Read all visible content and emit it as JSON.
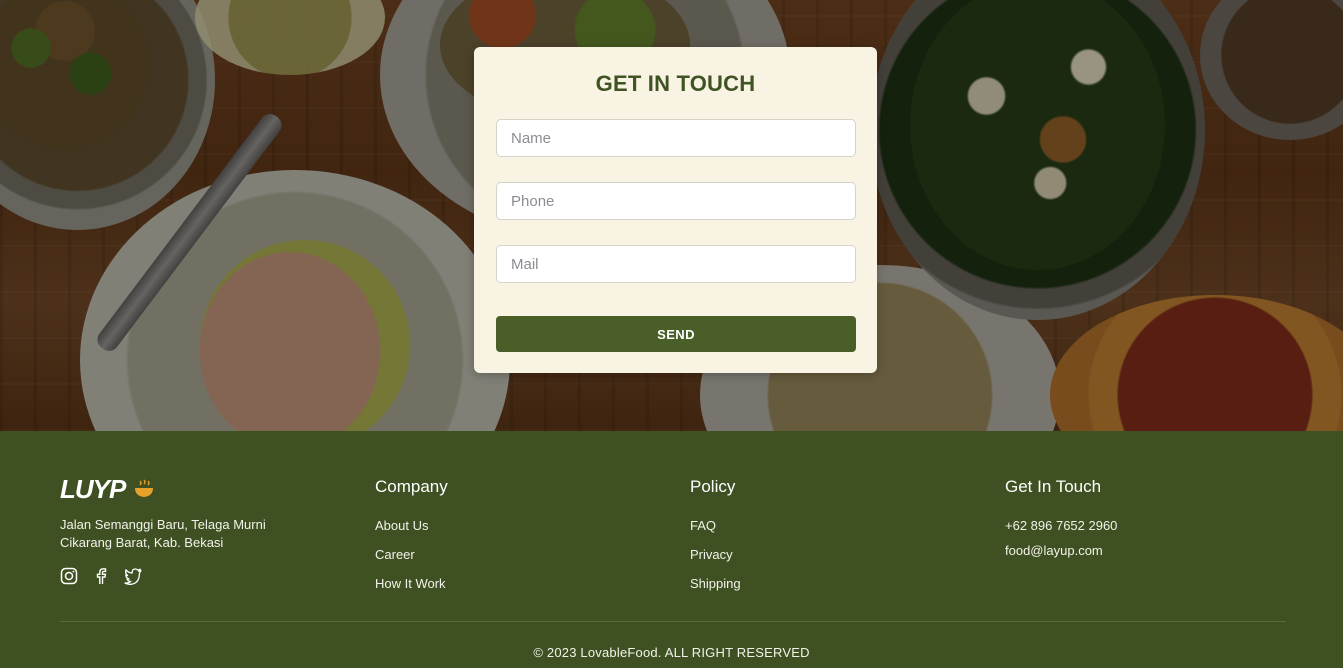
{
  "form": {
    "title": "GET IN TOUCH",
    "name_placeholder": "Name",
    "phone_placeholder": "Phone",
    "mail_placeholder": "Mail",
    "send_label": "SEND"
  },
  "footer": {
    "logo_text": "LUYP",
    "address": "Jalan Semanggi Baru, Telaga Murni Cikarang Barat, Kab. Bekasi",
    "social_icons": [
      "instagram-icon",
      "facebook-icon",
      "twitter-icon"
    ],
    "company": {
      "heading": "Company",
      "links": [
        "About Us",
        "Career",
        "How It Work"
      ]
    },
    "policy": {
      "heading": "Policy",
      "links": [
        "FAQ",
        "Privacy",
        "Shipping"
      ]
    },
    "contact": {
      "heading": "Get In Touch",
      "phone": "+62 896 7652 2960",
      "email": "food@layup.com"
    },
    "copyright": "© 2023 LovableFood. ALL RIGHT RESERVED"
  },
  "colors": {
    "accent_green": "#4a5e28",
    "footer_bg": "#3f5122",
    "card_bg": "#f8f3e2",
    "bowl_icon": "#e8a12a"
  }
}
